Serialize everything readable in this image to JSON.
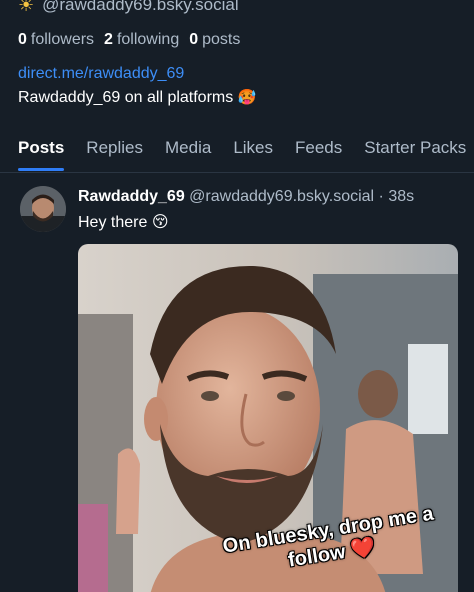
{
  "profile": {
    "handle": "@rawdaddy69.bsky.social",
    "followers_count": "0",
    "followers_label": "followers",
    "following_count": "2",
    "following_label": "following",
    "posts_count": "0",
    "posts_label": "posts",
    "link": "direct.me/rawdaddy_69",
    "bio": "Rawdaddy_69 on all platforms",
    "bio_emoji": "🥵"
  },
  "tabs": [
    {
      "label": "Posts",
      "active": true
    },
    {
      "label": "Replies"
    },
    {
      "label": "Media"
    },
    {
      "label": "Likes"
    },
    {
      "label": "Feeds"
    },
    {
      "label": "Starter Packs"
    }
  ],
  "post": {
    "author_name": "Rawdaddy_69",
    "author_handle": "@rawdaddy69.bsky.social",
    "separator": "·",
    "time": "38s",
    "text": "Hey there",
    "text_emoji": "😚",
    "image_caption": "On bluesky, drop me a follow",
    "caption_emoji": "❤️"
  },
  "icons": {
    "header": "sun-icon"
  },
  "colors": {
    "background": "#161e27",
    "link": "#3d8ef7",
    "muted": "#aebbc9",
    "active_tab_indicator": "#2f7df6"
  }
}
